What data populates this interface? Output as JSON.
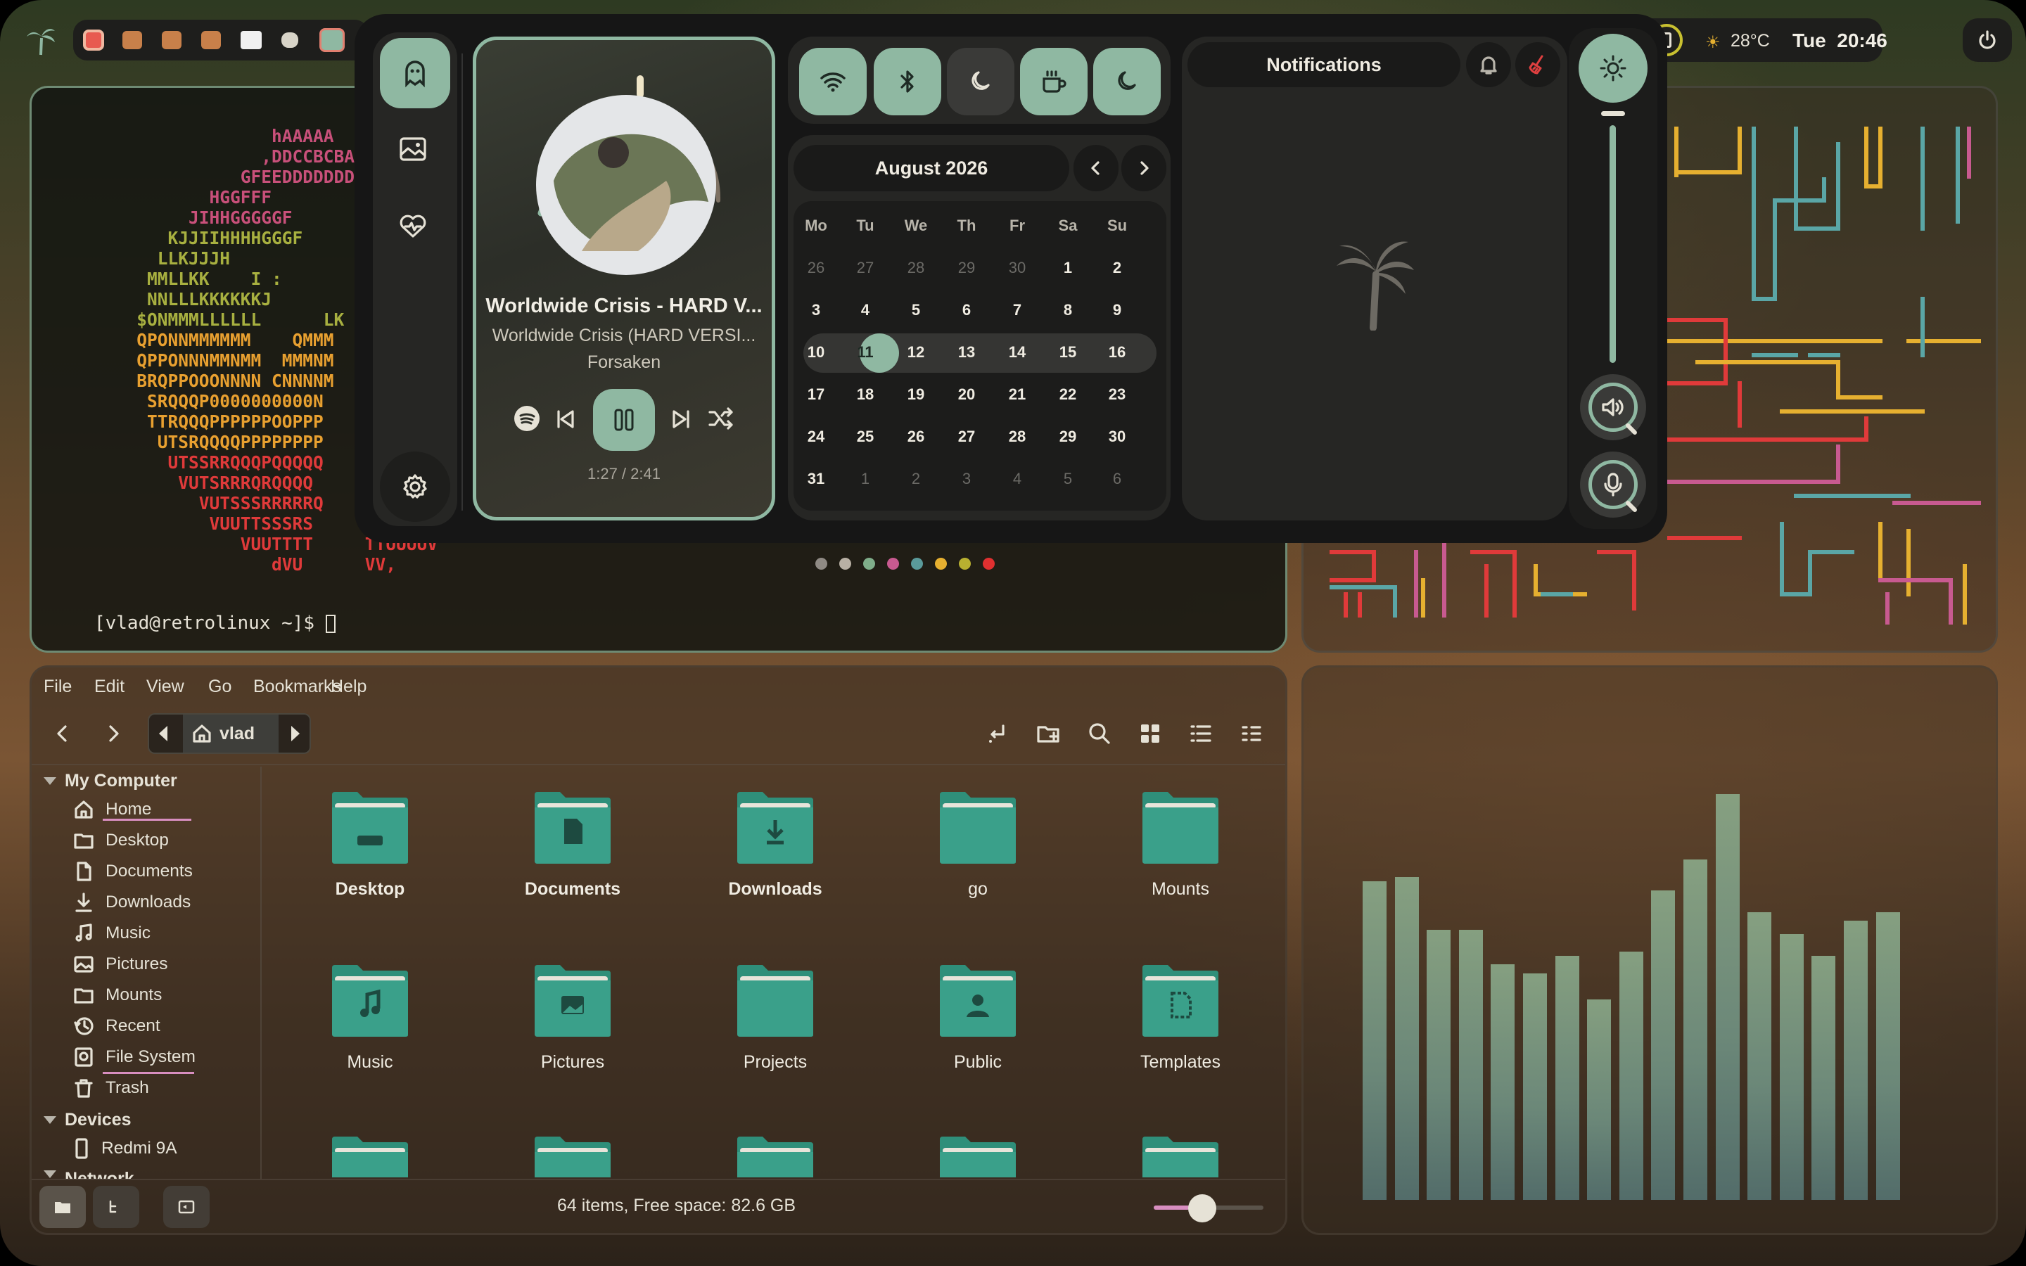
{
  "topbar": {
    "weather": "28°C",
    "clock": "Tue  20:46",
    "tray_icons": [
      "record-icon",
      "app-icon",
      "app-icon",
      "app-icon",
      "vpn-icon",
      "ghost-icon",
      "app-icon"
    ]
  },
  "terminal": {
    "prompt": "[vlad@retrolinux ~]$ ",
    "ascii_lines": [
      {
        "t": "                hAAAAA",
        "c": "#c8507a"
      },
      {
        "t": "               ,DDCCBCBACB",
        "c": "#c8507a"
      },
      {
        "t": "             GFEEDDDDDDDDD",
        "c": "#c8507a"
      },
      {
        "t": "          HGGFFF        EEF",
        "c": "#c8507a"
      },
      {
        "t": "        JIHHGGGGGF       GF",
        "c": "#c8507a"
      },
      {
        "t": "      KJJIIHHHHGGGF",
        "c": "#a8b040"
      },
      {
        "t": "     LLKJJJH",
        "c": "#a8b040"
      },
      {
        "t": "    MMLLKK    I :",
        "c": "#a8b040"
      },
      {
        "t": "    NNLLLKKKKKKJ",
        "c": "#a8b040"
      },
      {
        "t": "   $ONMMMLLLLLL      LK",
        "c": "#a8b040"
      },
      {
        "t": "   QPONNMMMMMM    QMMM",
        "c": "#e8a030"
      },
      {
        "t": "   QPPONNNMMNMM  MMMNM",
        "c": "#e8a030"
      },
      {
        "t": "   BRQPPOOONNNN CNNNNM",
        "c": "#e8a030"
      },
      {
        "t": "    SRQQQP0000000000N",
        "c": "#e8a030"
      },
      {
        "t": "    TTRQQQPPPPPPOOPPP",
        "c": "#e8a030"
      },
      {
        "t": "     UTSRQQQQPPPPPPPP",
        "c": "#e8a030"
      },
      {
        "t": "      UTSSRRQQQPQQQQQ",
        "c": "#e03a3a"
      },
      {
        "t": "       VUTSRRRQRQQQQ",
        "c": "#e03a3a"
      },
      {
        "t": "         VUTSSSRRRRRQ",
        "c": "#e03a3a"
      },
      {
        "t": "          VUUTTSSSRS",
        "c": "#e03a3a"
      },
      {
        "t": "             VUUTTTT     TTUUUUV",
        "c": "#e03a3a"
      },
      {
        "t": "                dVU      VV,",
        "c": "#e03a3a"
      }
    ]
  },
  "player": {
    "title": "Worldwide Crisis - HARD V...",
    "album": "Worldwide Crisis (HARD VERSI...",
    "artist": "Forsaken",
    "time": "1:27 / 2:41",
    "progress": 0.54
  },
  "toggles": [
    {
      "name": "wifi",
      "on": true
    },
    {
      "name": "bluetooth",
      "on": true
    },
    {
      "name": "night-light",
      "on": false
    },
    {
      "name": "caffeine",
      "on": true
    },
    {
      "name": "do-not-disturb",
      "on": true
    }
  ],
  "calendar": {
    "month": "August 2026",
    "weekdays": [
      "Mo",
      "Tu",
      "We",
      "Th",
      "Fr",
      "Sa",
      "Su"
    ],
    "weeks": [
      [
        "26",
        "27",
        "28",
        "29",
        "30",
        "1",
        "2"
      ],
      [
        "3",
        "4",
        "5",
        "6",
        "7",
        "8",
        "9"
      ],
      [
        "10",
        "11",
        "12",
        "13",
        "14",
        "15",
        "16"
      ],
      [
        "17",
        "18",
        "19",
        "20",
        "21",
        "22",
        "23"
      ],
      [
        "24",
        "25",
        "26",
        "27",
        "28",
        "29",
        "30"
      ],
      [
        "31",
        "1",
        "2",
        "3",
        "4",
        "5",
        "6"
      ]
    ],
    "today": "11"
  },
  "notifications": {
    "title": "Notifications"
  },
  "sliders": {
    "brightness": 1.0
  },
  "palette": [
    "#8f8a84",
    "#b8b0a4",
    "#7fae8a",
    "#c85a90",
    "#5a9a9a",
    "#e6b030",
    "#b8b030",
    "#e03030"
  ],
  "filemanager": {
    "menu": [
      "File",
      "Edit",
      "View",
      "Go",
      "Bookmarks",
      "Help"
    ],
    "location": "vlad",
    "sidebar_header": "My Computer",
    "sidebar": [
      "Home",
      "Desktop",
      "Documents",
      "Downloads",
      "Music",
      "Pictures",
      "Mounts",
      "Recent",
      "File System",
      "Trash"
    ],
    "devices_header": "Devices",
    "devices": [
      "Redmi 9A"
    ],
    "network_header": "Network",
    "folders": [
      "Desktop",
      "Documents",
      "Downloads",
      "go",
      "Mounts",
      "Music",
      "Pictures",
      "Projects",
      "Public",
      "Templates"
    ],
    "status": "64 items, Free space: 82.6 GB",
    "zoom": 0.6
  },
  "visualizer": {
    "values": [
      0.73,
      0.74,
      0.62,
      0.62,
      0.54,
      0.52,
      0.56,
      0.46,
      0.57,
      0.71,
      0.78,
      0.93,
      0.66,
      0.61,
      0.56,
      0.64,
      0.66
    ]
  }
}
